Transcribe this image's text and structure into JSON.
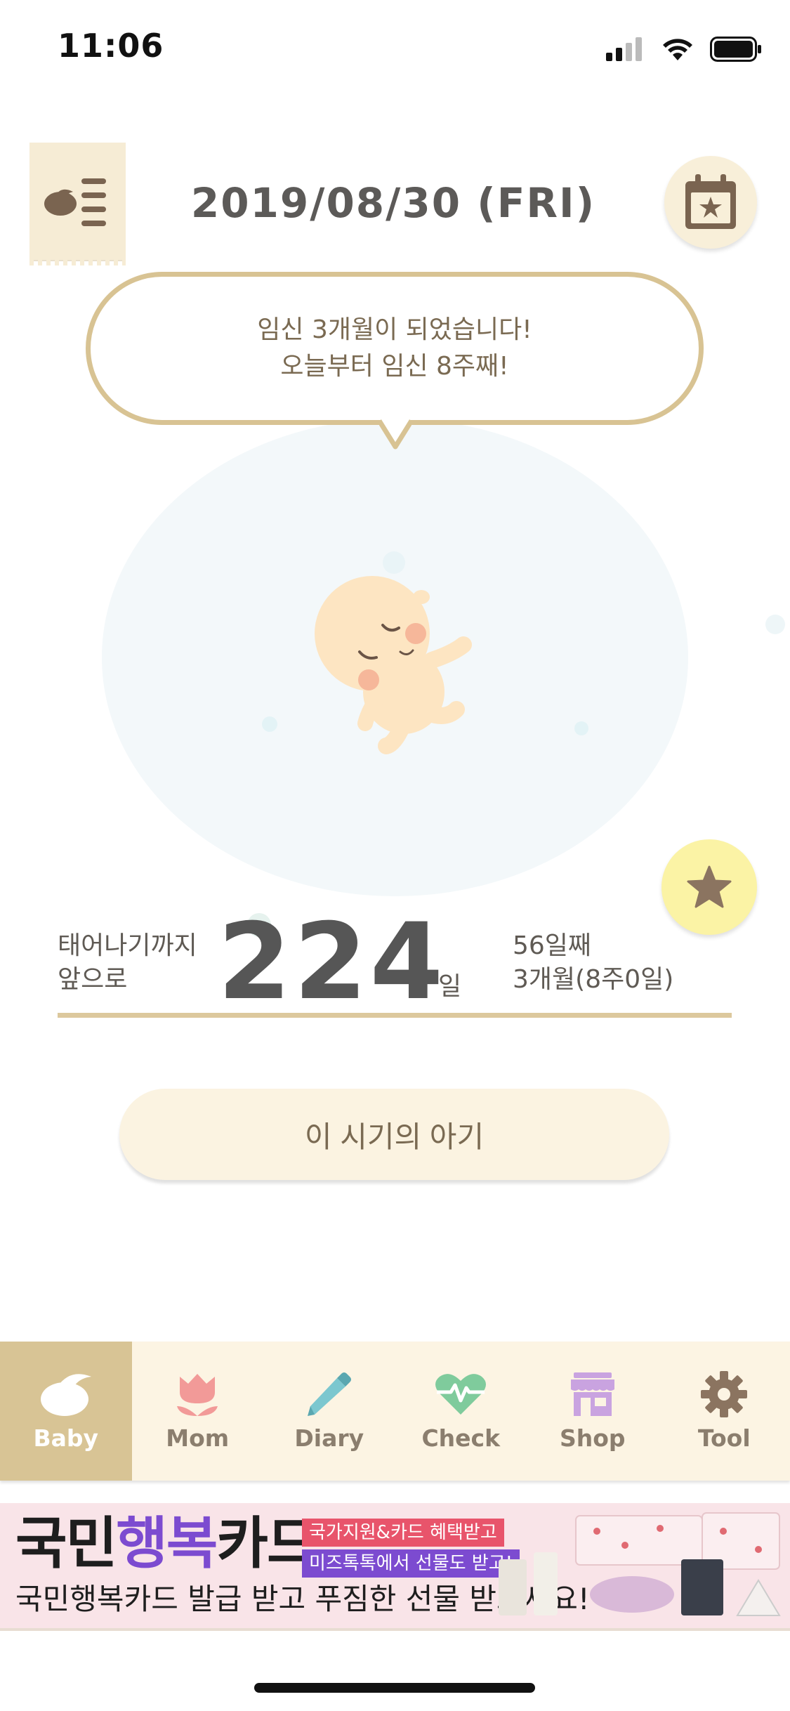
{
  "status_bar": {
    "time": "11:06"
  },
  "header": {
    "date": "2019/08/30 (FRI)"
  },
  "speech": {
    "line1": "임신 3개월이 되었습니다!",
    "line2": "오늘부터 임신 8주째!"
  },
  "countdown": {
    "label_line1": "태어나기까지",
    "label_line2": "앞으로",
    "days_left": "224",
    "unit": "일",
    "day_count": "56일째",
    "month_week": "3개월(8주0일)"
  },
  "period_button": {
    "label": "이 시기의 아기"
  },
  "tabs": [
    {
      "label": "Baby",
      "icon": "baby-bird-icon",
      "active": true
    },
    {
      "label": "Mom",
      "icon": "tulip-icon",
      "active": false
    },
    {
      "label": "Diary",
      "icon": "pencil-icon",
      "active": false
    },
    {
      "label": "Check",
      "icon": "heart-pulse-icon",
      "active": false
    },
    {
      "label": "Shop",
      "icon": "shop-icon",
      "active": false
    },
    {
      "label": "Tool",
      "icon": "gear-icon",
      "active": false
    }
  ],
  "ad": {
    "title_part1": "국민",
    "title_highlight": "행복",
    "title_part2": "카드",
    "badge1": "국가지원&카드 혜택받고",
    "badge2": "미즈톡톡에서 선물도 받고!",
    "subtitle": "국민행복카드 발급 받고 푸짐한 선물 받으세요!"
  },
  "colors": {
    "accent": "#d8c495",
    "tab_bg": "#fcf4e3",
    "bubble_border": "#d8c393",
    "star_bg": "#fbf3a5",
    "icon_brown": "#8b7460"
  }
}
